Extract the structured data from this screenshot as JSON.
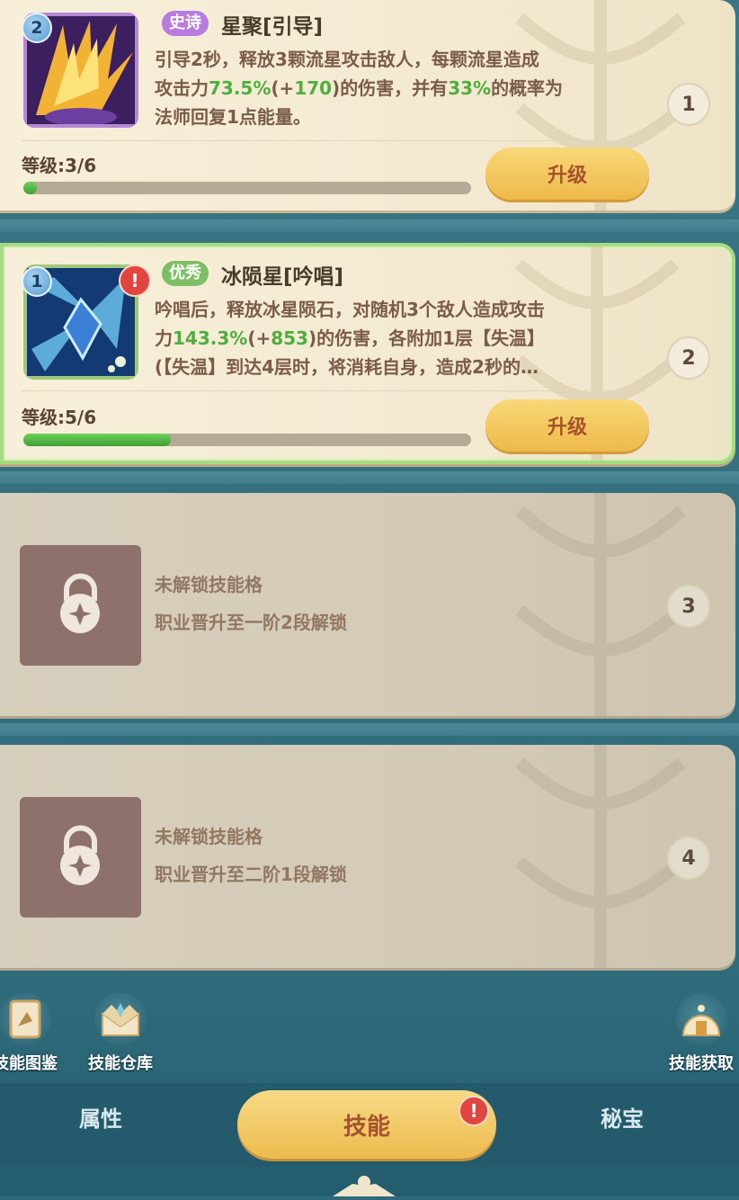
{
  "slots": [
    {
      "slot_number": "1",
      "icon_level": "2",
      "rarity": "史诗",
      "name": "星聚[引导]",
      "desc_lines": [
        [
          "引导2秒，释放3颗流星攻击敌人，每颗流星造成"
        ],
        [
          "攻击力",
          "73.5%",
          "(+",
          "170",
          ")的伤害，并有",
          "33%",
          "的概率为"
        ],
        [
          "法师回复1点能量。"
        ]
      ],
      "level_text": "等级:3/6",
      "progress": 0.03,
      "button": "升级"
    },
    {
      "slot_number": "2",
      "icon_level": "1",
      "alert": "!",
      "rarity": "优秀",
      "name": "冰陨星[吟唱]",
      "desc_lines": [
        [
          "吟唱后，释放冰星陨石，对随机3个敌人造成攻击"
        ],
        [
          "力",
          "143.3%",
          "(+",
          "853",
          ")的伤害，各附加1层【失温】"
        ],
        [
          "(【失温】到达4层时，将消耗自身，造成2秒的…"
        ]
      ],
      "level_text": "等级:5/6",
      "progress": 0.33,
      "button": "升级"
    },
    {
      "slot_number": "3",
      "locked_title": "未解锁技能格",
      "locked_hint": "职业晋升至一阶2段解锁"
    },
    {
      "slot_number": "4",
      "locked_title": "未解锁技能格",
      "locked_hint": "职业晋升至二阶1段解锁"
    }
  ],
  "side_buttons": {
    "codex": "技能图鉴",
    "storage": "技能仓库",
    "acquire": "技能获取"
  },
  "tabs": {
    "attributes": "属性",
    "skills": "技能",
    "skills_alert": "!",
    "treasure": "秘宝"
  },
  "colors": {
    "progress_fill": "#4fae3d",
    "accent_button": "#eeb94b",
    "epic": "#b87ce0",
    "good": "#7fbf63",
    "alert": "#e2443f"
  }
}
